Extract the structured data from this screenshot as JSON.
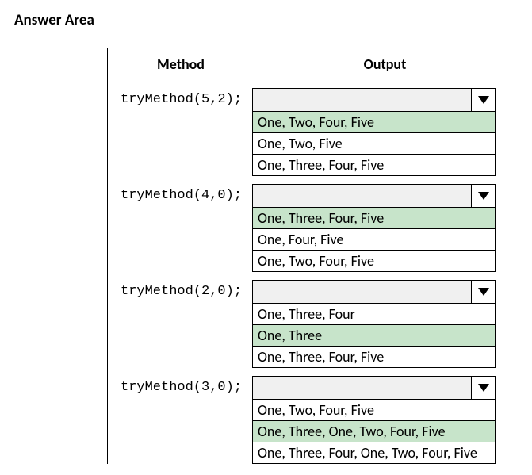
{
  "title": "Answer Area",
  "headers": {
    "method": "Method",
    "output": "Output"
  },
  "rows": [
    {
      "method": "tryMethod(5,2);",
      "selected": "",
      "options": [
        {
          "label": "One, Two, Four, Five",
          "highlighted": true
        },
        {
          "label": "One, Two, Five",
          "highlighted": false
        },
        {
          "label": "One, Three, Four, Five",
          "highlighted": false
        }
      ]
    },
    {
      "method": "tryMethod(4,0);",
      "selected": "",
      "options": [
        {
          "label": "One, Three, Four, Five",
          "highlighted": true
        },
        {
          "label": "One, Four, Five",
          "highlighted": false
        },
        {
          "label": "One, Two, Four, Five",
          "highlighted": false
        }
      ]
    },
    {
      "method": "tryMethod(2,0);",
      "selected": "",
      "options": [
        {
          "label": "One, Three, Four",
          "highlighted": false
        },
        {
          "label": "One, Three",
          "highlighted": true
        },
        {
          "label": "One, Three, Four, Five",
          "highlighted": false
        }
      ]
    },
    {
      "method": "tryMethod(3,0);",
      "selected": "",
      "options": [
        {
          "label": "One, Two, Four, Five",
          "highlighted": false
        },
        {
          "label": "One, Three, One, Two, Four, Five",
          "highlighted": true
        },
        {
          "label": "One, Three, Four, One, Two, Four, Five",
          "highlighted": false
        }
      ]
    }
  ]
}
